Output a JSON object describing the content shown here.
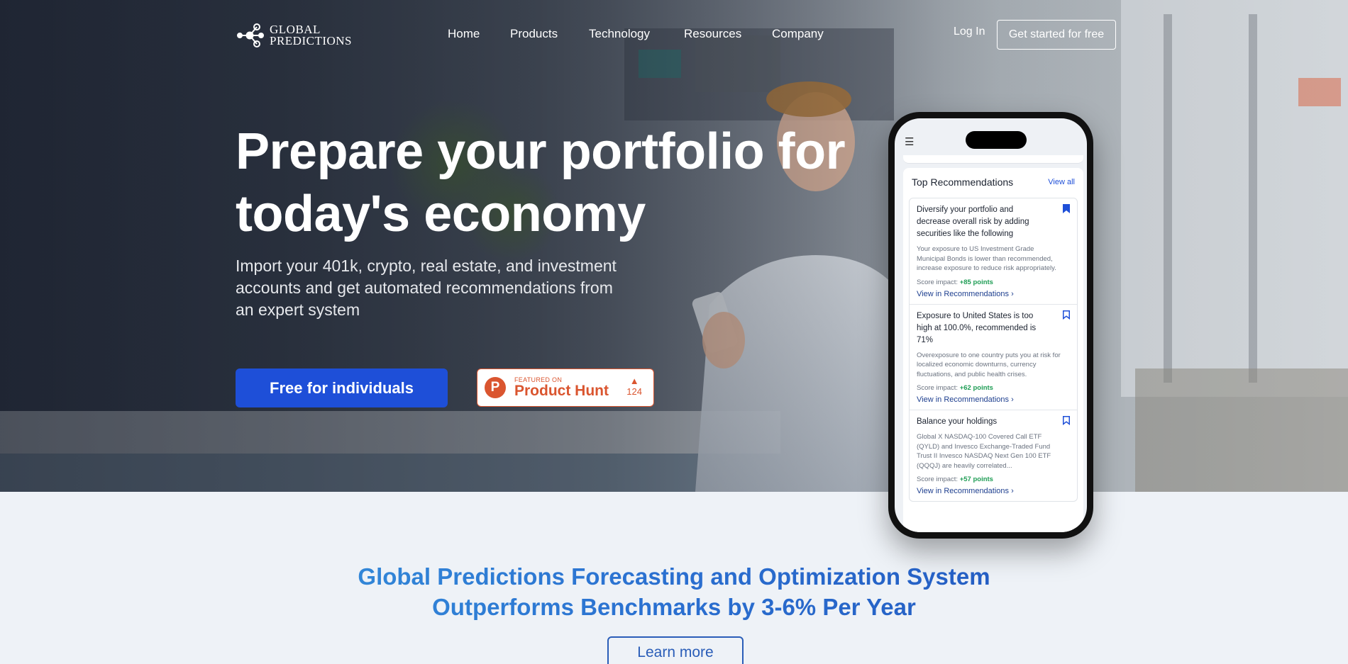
{
  "brand": {
    "line1": "Global",
    "line2": "Predictions"
  },
  "nav": {
    "links": [
      "Home",
      "Products",
      "Technology",
      "Resources",
      "Company"
    ],
    "login": "Log In",
    "cta": "Get started for free"
  },
  "hero": {
    "headline_line1": "Prepare your portfolio for",
    "headline_line2": "today's economy",
    "subhead": "Import your 401k, crypto, real estate, and investment accounts and get automated recommendations from an expert system",
    "primary_button": "Free for individuals",
    "product_hunt": {
      "featured": "FEATURED ON",
      "name": "Product Hunt",
      "votes": "124"
    }
  },
  "phone": {
    "panel_title": "Top Recommendations",
    "view_all": "View all",
    "items": [
      {
        "title": "Diversify your portfolio and decrease overall risk by adding securities like the following",
        "desc": "Your exposure to US Investment Grade Municipal Bonds is lower than recommended, increase exposure to reduce risk appropriately.",
        "score_label": "Score impact:",
        "score_value": "+85 points",
        "link": "View in Recommendations ›",
        "bookmarked": true
      },
      {
        "title": "Exposure to United States is too high at 100.0%, recommended is 71%",
        "desc": "Overexposure to one country puts you at risk for localized economic downturns, currency fluctuations, and public health crises.",
        "score_label": "Score impact:",
        "score_value": "+62 points",
        "link": "View in Recommendations ›",
        "bookmarked": false
      },
      {
        "title": "Balance your holdings",
        "desc": "Global X NASDAQ-100 Covered Call ETF (QYLD) and Invesco Exchange-Traded Fund Trust II Invesco NASDAQ Next Gen 100 ETF (QQQJ) are heavily correlated...",
        "score_label": "Score impact:",
        "score_value": "+57 points",
        "link": "View in Recommendations ›",
        "bookmarked": false
      }
    ]
  },
  "lower": {
    "title_line1": "Global Predictions Forecasting and Optimization System",
    "title_line2": "Outperforms Benchmarks by 3-6% Per Year",
    "button": "Learn more"
  },
  "colors": {
    "primary_blue": "#1e4fd8",
    "product_hunt": "#da552f",
    "score_green": "#1f9d55",
    "lower_bg": "#eef2f7"
  }
}
